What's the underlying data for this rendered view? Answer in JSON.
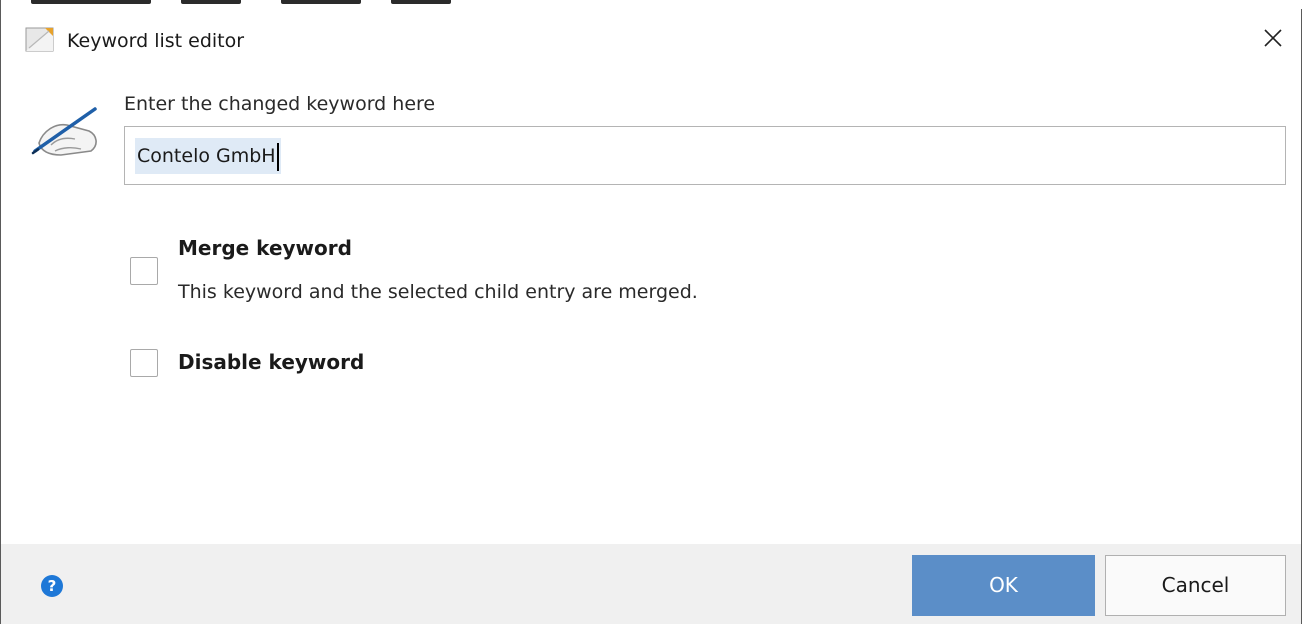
{
  "window": {
    "title": "Keyword list editor",
    "icon": "app-window-icon",
    "close_icon": "close-icon"
  },
  "form": {
    "field_label": "Enter the changed keyword here",
    "keyword_value": "Contelo GmbH",
    "icon": "pen-hand-icon"
  },
  "options": {
    "merge": {
      "title": "Merge keyword",
      "description": "This keyword and the selected child entry are merged.",
      "checked": false
    },
    "disable": {
      "title": "Disable keyword",
      "checked": false
    }
  },
  "footer": {
    "help_icon": "help-icon",
    "ok_label": "OK",
    "cancel_label": "Cancel"
  },
  "colors": {
    "primary_button": "#5b8ec8",
    "help_icon": "#1e78d7",
    "footer_bg": "#f0f0f0",
    "selection_bg": "#dfeaf6"
  }
}
